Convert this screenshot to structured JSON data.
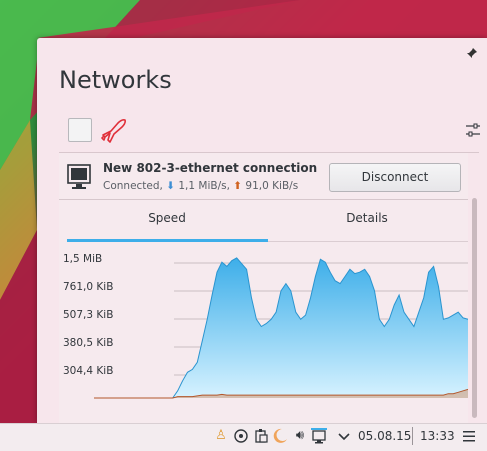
{
  "popup": {
    "title": "Networks",
    "airplane_color": "#e0303a"
  },
  "connection": {
    "name": "New 802-3-ethernet connection",
    "status_prefix": "Connected, ",
    "download_arrow": "⬇",
    "download": " 1,1 MiB/s, ",
    "upload_arrow": "⬆",
    "upload": " 91,0 KiB/s",
    "disconnect_label": "Disconnect"
  },
  "tabs": {
    "speed": "Speed",
    "details": "Details",
    "active": "Speed"
  },
  "chart_data": {
    "type": "area",
    "y_tick_labels": [
      "1,5 MiB",
      "761,0 KiB",
      "507,3 KiB",
      "380,5 KiB",
      "304,4 KiB"
    ],
    "series": [
      {
        "color": "#3daee9",
        "values": [
          0,
          0,
          0,
          0,
          0,
          0,
          0,
          0,
          0,
          0,
          0,
          0,
          0,
          0,
          0,
          0,
          0,
          0.05,
          0.12,
          0.18,
          0.2,
          0.25,
          0.4,
          0.55,
          0.72,
          0.88,
          0.95,
          0.92,
          0.96,
          0.98,
          0.94,
          0.9,
          0.7,
          0.55,
          0.5,
          0.52,
          0.55,
          0.6,
          0.75,
          0.8,
          0.75,
          0.6,
          0.55,
          0.58,
          0.7,
          0.85,
          0.97,
          0.95,
          0.88,
          0.82,
          0.8,
          0.85,
          0.9,
          0.87,
          0.88,
          0.9,
          0.85,
          0.75,
          0.55,
          0.5,
          0.55,
          0.65,
          0.72,
          0.6,
          0.55,
          0.5,
          0.6,
          0.7,
          0.88,
          0.92,
          0.78,
          0.55,
          0.56,
          0.58,
          0.6,
          0.56,
          0.55
        ]
      },
      {
        "color": "#d0621f",
        "values": [
          0,
          0,
          0,
          0,
          0,
          0,
          0,
          0,
          0,
          0,
          0,
          0,
          0,
          0,
          0,
          0,
          0,
          0.01,
          0.01,
          0.01,
          0.01,
          0.015,
          0.02,
          0.02,
          0.02,
          0.02,
          0.025,
          0.02,
          0.02,
          0.02,
          0.02,
          0.02,
          0.02,
          0.02,
          0.02,
          0.02,
          0.02,
          0.02,
          0.02,
          0.02,
          0.02,
          0.02,
          0.02,
          0.02,
          0.02,
          0.02,
          0.02,
          0.02,
          0.02,
          0.02,
          0.02,
          0.02,
          0.02,
          0.02,
          0.02,
          0.02,
          0.02,
          0.02,
          0.02,
          0.02,
          0.02,
          0.02,
          0.02,
          0.02,
          0.02,
          0.02,
          0.02,
          0.02,
          0.02,
          0.02,
          0.02,
          0.02,
          0.03,
          0.03,
          0.04,
          0.05,
          0.06
        ]
      }
    ]
  },
  "panel": {
    "date": "05.08.15",
    "time": "13:33"
  }
}
